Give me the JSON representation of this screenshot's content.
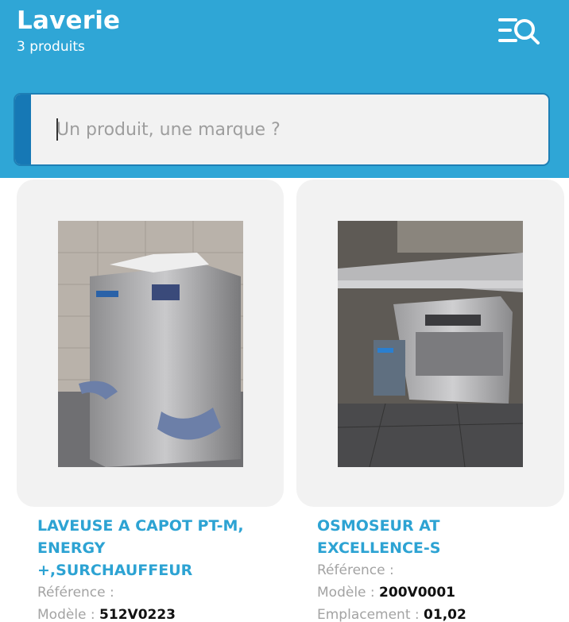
{
  "header": {
    "title": "Laverie",
    "subtitle": "3 produits",
    "filter_icon": "filter-search-icon"
  },
  "search": {
    "placeholder": "Un produit, une marque ?",
    "value": ""
  },
  "products": [
    {
      "name_lines": [
        "LAVEUSE A CAPOT PT-M,",
        "ENERGY",
        "+,SURCHAUFFEUR"
      ],
      "reference_label": "Référence :",
      "reference_value": "",
      "model_label": "Modèle : ",
      "model_value": "512V0223"
    },
    {
      "name_lines": [
        "OSMOSEUR AT",
        "EXCELLENCE-S"
      ],
      "reference_label": "Référence :",
      "reference_value": "",
      "model_label": "Modèle : ",
      "model_value": "200V0001",
      "location_label": "Emplacement : ",
      "location_value": "01,02"
    }
  ],
  "colors": {
    "header_bg": "#2fa6d6",
    "accent": "#1678b5",
    "product_name": "#2da3d3",
    "card_bg": "#f2f2f2"
  }
}
